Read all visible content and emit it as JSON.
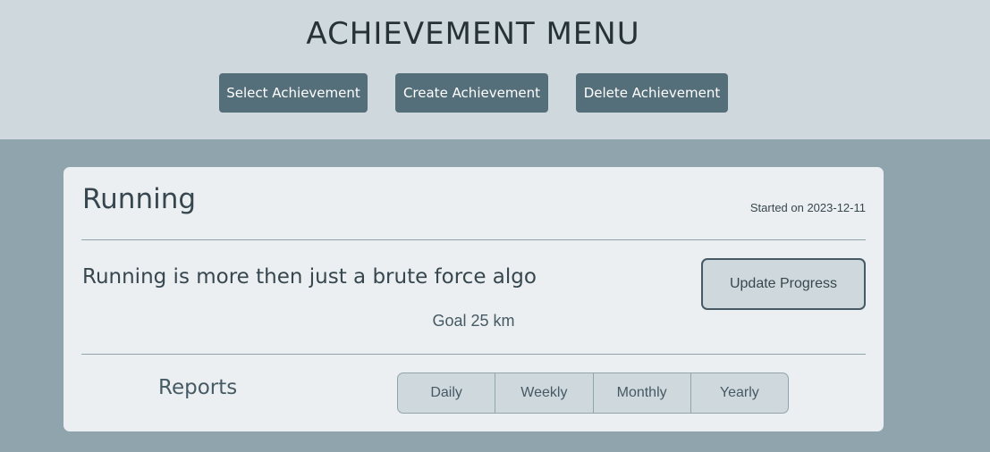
{
  "header": {
    "title": "ACHIEVEMENT MENU",
    "buttons": {
      "select": "Select Achievement",
      "create": "Create Achievement",
      "delete": "Delete Achievement"
    }
  },
  "achievement": {
    "name": "Running",
    "started": "Started on 2023-12-11",
    "description": "Running is more then just a brute force algo",
    "goal": "Goal 25 km",
    "update_label": "Update Progress"
  },
  "reports": {
    "label": "Reports",
    "periods": [
      "Daily",
      "Weekly",
      "Monthly",
      "Yearly"
    ]
  },
  "colors": {
    "header_bg": "#cfd8dc",
    "page_bg": "#90a4ae",
    "button_bg": "#546e7a",
    "card_bg": "#eceff1",
    "text": "#37474f"
  }
}
